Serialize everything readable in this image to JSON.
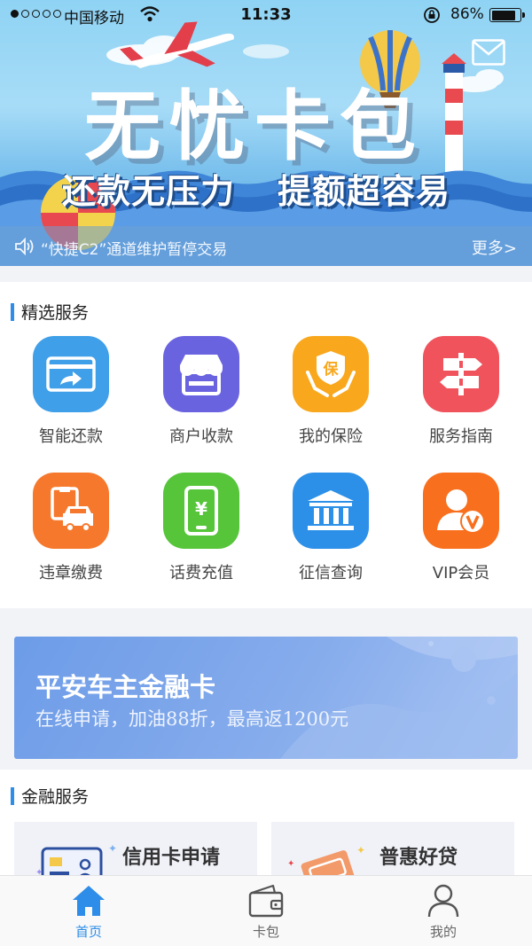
{
  "status_bar": {
    "carrier": "中国移动",
    "time": "11:33",
    "battery": "86%",
    "battery_level": 0.86
  },
  "hero": {
    "title": "无忧卡包",
    "subtitle_left": "还款无压力",
    "subtitle_right": "提额超容易",
    "notice": "“快捷C2”通道维护暂停交易",
    "notice_more": "更多>"
  },
  "featured": {
    "heading": "精选服务",
    "items": [
      {
        "label": "智能还款",
        "icon": "card-repay-icon",
        "color": "#3f9fe8"
      },
      {
        "label": "商户收款",
        "icon": "store-icon",
        "color": "#6a63e0"
      },
      {
        "label": "我的保险",
        "icon": "insurance-icon",
        "color": "#f9a71c"
      },
      {
        "label": "服务指南",
        "icon": "signpost-icon",
        "color": "#f0535c"
      },
      {
        "label": "违章缴费",
        "icon": "car-fine-icon",
        "color": "#f6782c"
      },
      {
        "label": "话费充值",
        "icon": "phone-topup-icon",
        "color": "#56c53a"
      },
      {
        "label": "征信查询",
        "icon": "bank-icon",
        "color": "#2d90e8"
      },
      {
        "label": "VIP会员",
        "icon": "vip-member-icon",
        "color": "#f86f1e"
      }
    ]
  },
  "promo": {
    "title": "平安车主金融卡",
    "subtitle": "在线申请，加油88折，最高返1200元"
  },
  "finance": {
    "heading": "金融服务",
    "cards": [
      {
        "label": "信用卡申请",
        "icon": "credit-card-apply-icon"
      },
      {
        "label": "普惠好贷",
        "icon": "loan-icon"
      }
    ]
  },
  "tab_bar": {
    "tabs": [
      {
        "label": "首页",
        "icon": "home-icon",
        "active": true
      },
      {
        "label": "卡包",
        "icon": "wallet-icon",
        "active": false
      },
      {
        "label": "我的",
        "icon": "user-icon",
        "active": false
      }
    ],
    "active_color": "#2e8de8"
  }
}
